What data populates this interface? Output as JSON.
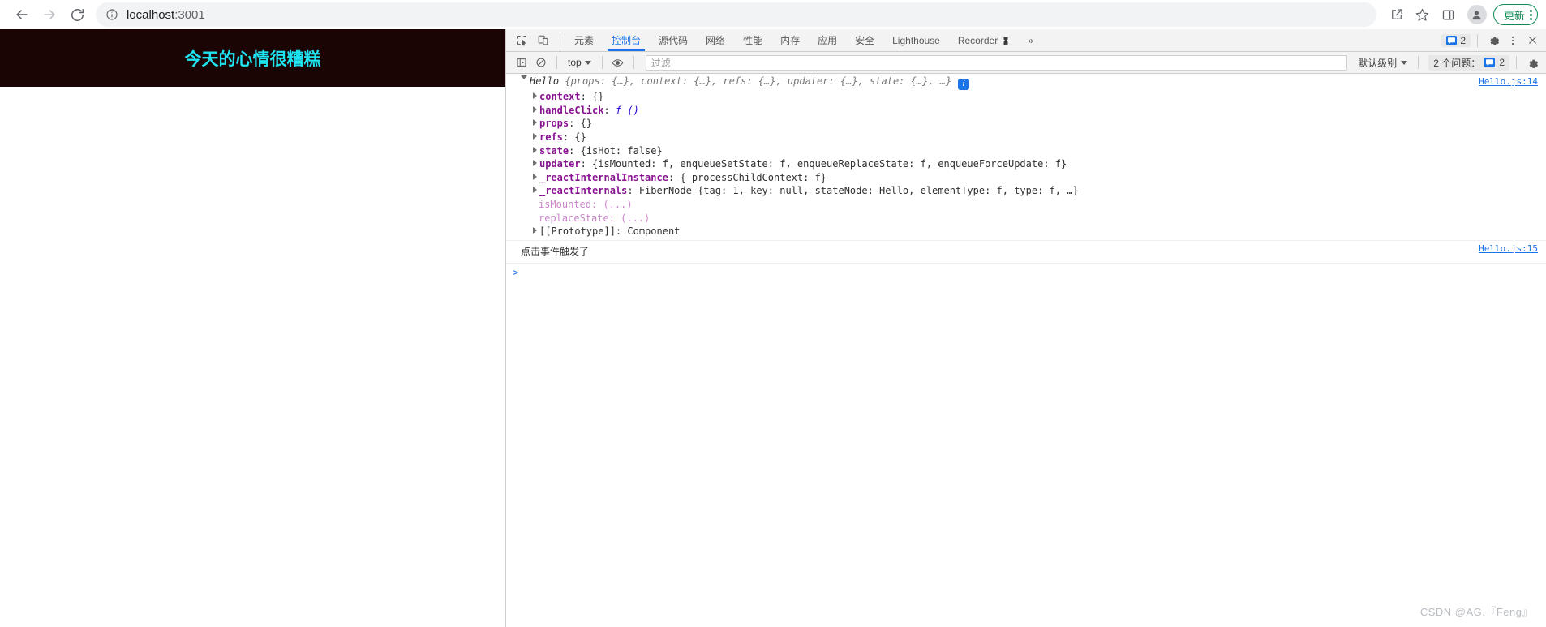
{
  "browser": {
    "back_label": "back",
    "forward_label": "forward",
    "reload_label": "reload",
    "url_host": "localhost",
    "url_port": ":3001",
    "share_label": "share",
    "bookmark_label": "bookmark",
    "side_panel_label": "side panel",
    "profile_label": "profile",
    "update_label": "更新",
    "menu_label": "menu"
  },
  "page": {
    "heading": "今天的心情很糟糕",
    "banner_bg": "#1a0404",
    "heading_color": "#1ee3f0",
    "watermark": "CSDN @AG.『Feng』"
  },
  "devtools": {
    "inspect_icon_label": "inspect-element",
    "device_icon_label": "toggle-device-toolbar",
    "tabs": [
      {
        "label": "元素",
        "active": false
      },
      {
        "label": "控制台",
        "active": true
      },
      {
        "label": "源代码",
        "active": false
      },
      {
        "label": "网络",
        "active": false
      },
      {
        "label": "性能",
        "active": false
      },
      {
        "label": "内存",
        "active": false
      },
      {
        "label": "应用",
        "active": false
      },
      {
        "label": "安全",
        "active": false
      },
      {
        "label": "Lighthouse",
        "active": false
      },
      {
        "label": "Recorder",
        "active": false,
        "icon": "record-icon"
      }
    ],
    "overflow_label": "»",
    "message_count": "2",
    "settings_label": "settings",
    "more_label": "more options",
    "close_label": "close devtools",
    "console_toolbar": {
      "sidebar_toggle_label": "console-sidebar",
      "clear_label": "clear console",
      "context": "top",
      "eye_label": "live expressions",
      "filter_placeholder": "过滤",
      "level": "默认级别",
      "issues_label": "2 个问题：",
      "issues_count": "2",
      "settings_label": "console settings"
    },
    "console": {
      "messages": [
        {
          "source": "Hello.js:14",
          "header": {
            "class_name": "Hello",
            "preview": "{props: {…}, context: {…}, refs: {…}, updater: {…}, state: {…}, …}",
            "info_badge": "i"
          },
          "rows": [
            {
              "indent": 1,
              "arrow": true,
              "name": "context",
              "name_style": "prop",
              "value": "{}"
            },
            {
              "indent": 1,
              "arrow": true,
              "name": "handleClick",
              "name_style": "prop",
              "value": "f ()"
            },
            {
              "indent": 1,
              "arrow": true,
              "name": "props",
              "name_style": "prop",
              "value": "{}"
            },
            {
              "indent": 1,
              "arrow": true,
              "name": "refs",
              "name_style": "prop",
              "value": "{}"
            },
            {
              "indent": 1,
              "arrow": true,
              "name": "state",
              "name_style": "prop",
              "value": "{isHot: false}"
            },
            {
              "indent": 1,
              "arrow": true,
              "name": "updater",
              "name_style": "prop",
              "value": "{isMounted: f, enqueueSetState: f, enqueueReplaceState: f, enqueueForceUpdate: f}"
            },
            {
              "indent": 1,
              "arrow": true,
              "name": "_reactInternalInstance",
              "name_style": "prop",
              "value": "{_processChildContext: f}"
            },
            {
              "indent": 1,
              "arrow": true,
              "name": "_reactInternals",
              "name_style": "prop",
              "value": "FiberNode {tag: 1, key: null, stateNode: Hello, elementType: f, type: f, …}"
            },
            {
              "indent": 2,
              "arrow": false,
              "name": "isMounted",
              "name_style": "getter",
              "value": "(...)"
            },
            {
              "indent": 2,
              "arrow": false,
              "name": "replaceState",
              "name_style": "getter",
              "value": "(...)"
            },
            {
              "indent": 1,
              "arrow": true,
              "name": "[[Prototype]]",
              "name_style": "prop-dim",
              "value": "Component"
            }
          ]
        },
        {
          "source": "Hello.js:15",
          "text": "点击事件触发了"
        }
      ],
      "prompt": ">"
    }
  }
}
